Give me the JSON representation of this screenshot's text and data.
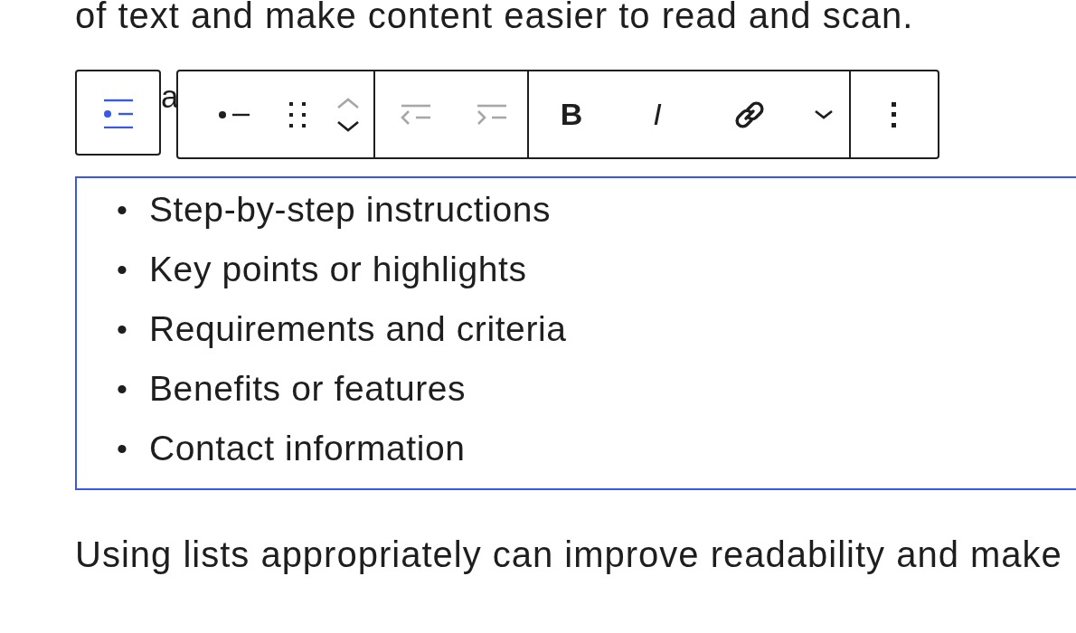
{
  "top_paragraph": "of text and make content easier to read and scan.",
  "hidden_paragraph_start": "a",
  "block_switcher": {
    "selected": true
  },
  "toolbar_groups": [
    [
      {
        "kind": "list-style",
        "disabled": false
      },
      {
        "kind": "drag",
        "disabled": false
      },
      {
        "kind": "mover",
        "up_disabled": true,
        "down_disabled": false
      }
    ],
    [
      {
        "kind": "outdent",
        "disabled": true
      },
      {
        "kind": "indent",
        "disabled": true
      }
    ],
    [
      {
        "kind": "bold",
        "label": "B",
        "disabled": false
      },
      {
        "kind": "italic",
        "label": "I",
        "disabled": false
      },
      {
        "kind": "link",
        "disabled": false
      },
      {
        "kind": "more-formats",
        "disabled": false
      }
    ],
    [
      {
        "kind": "options",
        "disabled": false
      }
    ]
  ],
  "list_items": [
    {
      "marker": "•",
      "text": "Step-by-step instructions"
    },
    {
      "marker": "•",
      "text": "Key points or highlights"
    },
    {
      "marker": "•",
      "text": "Requirements and criteria"
    },
    {
      "marker": "•",
      "text": "Benefits or features"
    },
    {
      "marker": "•",
      "text": "Contact information"
    }
  ],
  "bottom_paragraph": "Using lists appropriately can improve readability and make"
}
